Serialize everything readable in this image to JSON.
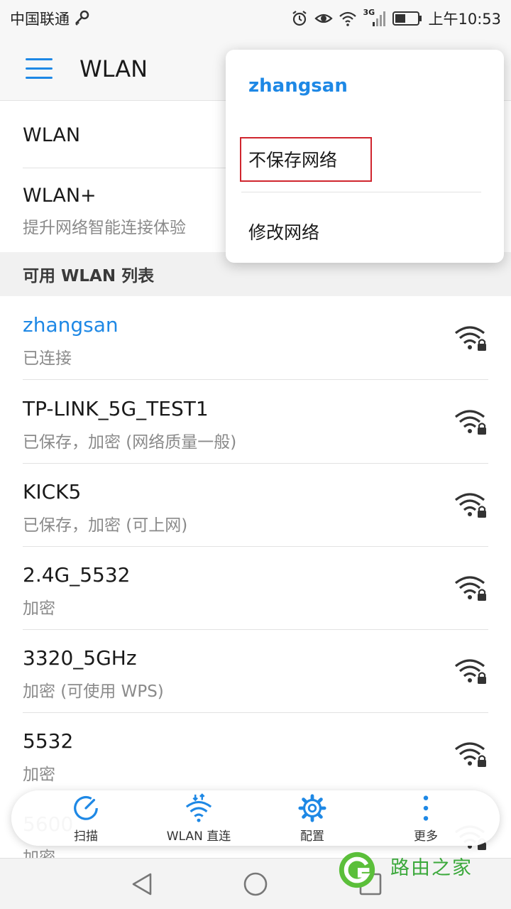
{
  "status_bar": {
    "carrier": "中国联通",
    "network_type": "3G",
    "time": "上午10:53"
  },
  "app_bar": {
    "title": "WLAN"
  },
  "settings": {
    "wlan_label": "WLAN",
    "wlan_plus_label": "WLAN+",
    "wlan_plus_sub": "提升网络智能连接体验"
  },
  "list_header": "可用 WLAN 列表",
  "networks": [
    {
      "name": "zhangsan",
      "status": "已连接"
    },
    {
      "name": "TP-LINK_5G_TEST1",
      "status": "已保存，加密 (网络质量一般)"
    },
    {
      "name": "KICK5",
      "status": "已保存，加密 (可上网)"
    },
    {
      "name": "2.4G_5532",
      "status": "加密"
    },
    {
      "name": "3320_5GHz",
      "status": "加密 (可使用 WPS)"
    },
    {
      "name": "5532",
      "status": "加密"
    },
    {
      "name": "5600",
      "status": "加密"
    }
  ],
  "popup": {
    "title": "zhangsan",
    "forget": "不保存网络",
    "modify": "修改网络"
  },
  "toolbar": {
    "scan": "扫描",
    "wlan_direct": "WLAN 直连",
    "config": "配置",
    "more": "更多"
  },
  "watermark": "路由之家",
  "colors": {
    "accent": "#1e88e5",
    "highlight": "#d0262e"
  }
}
